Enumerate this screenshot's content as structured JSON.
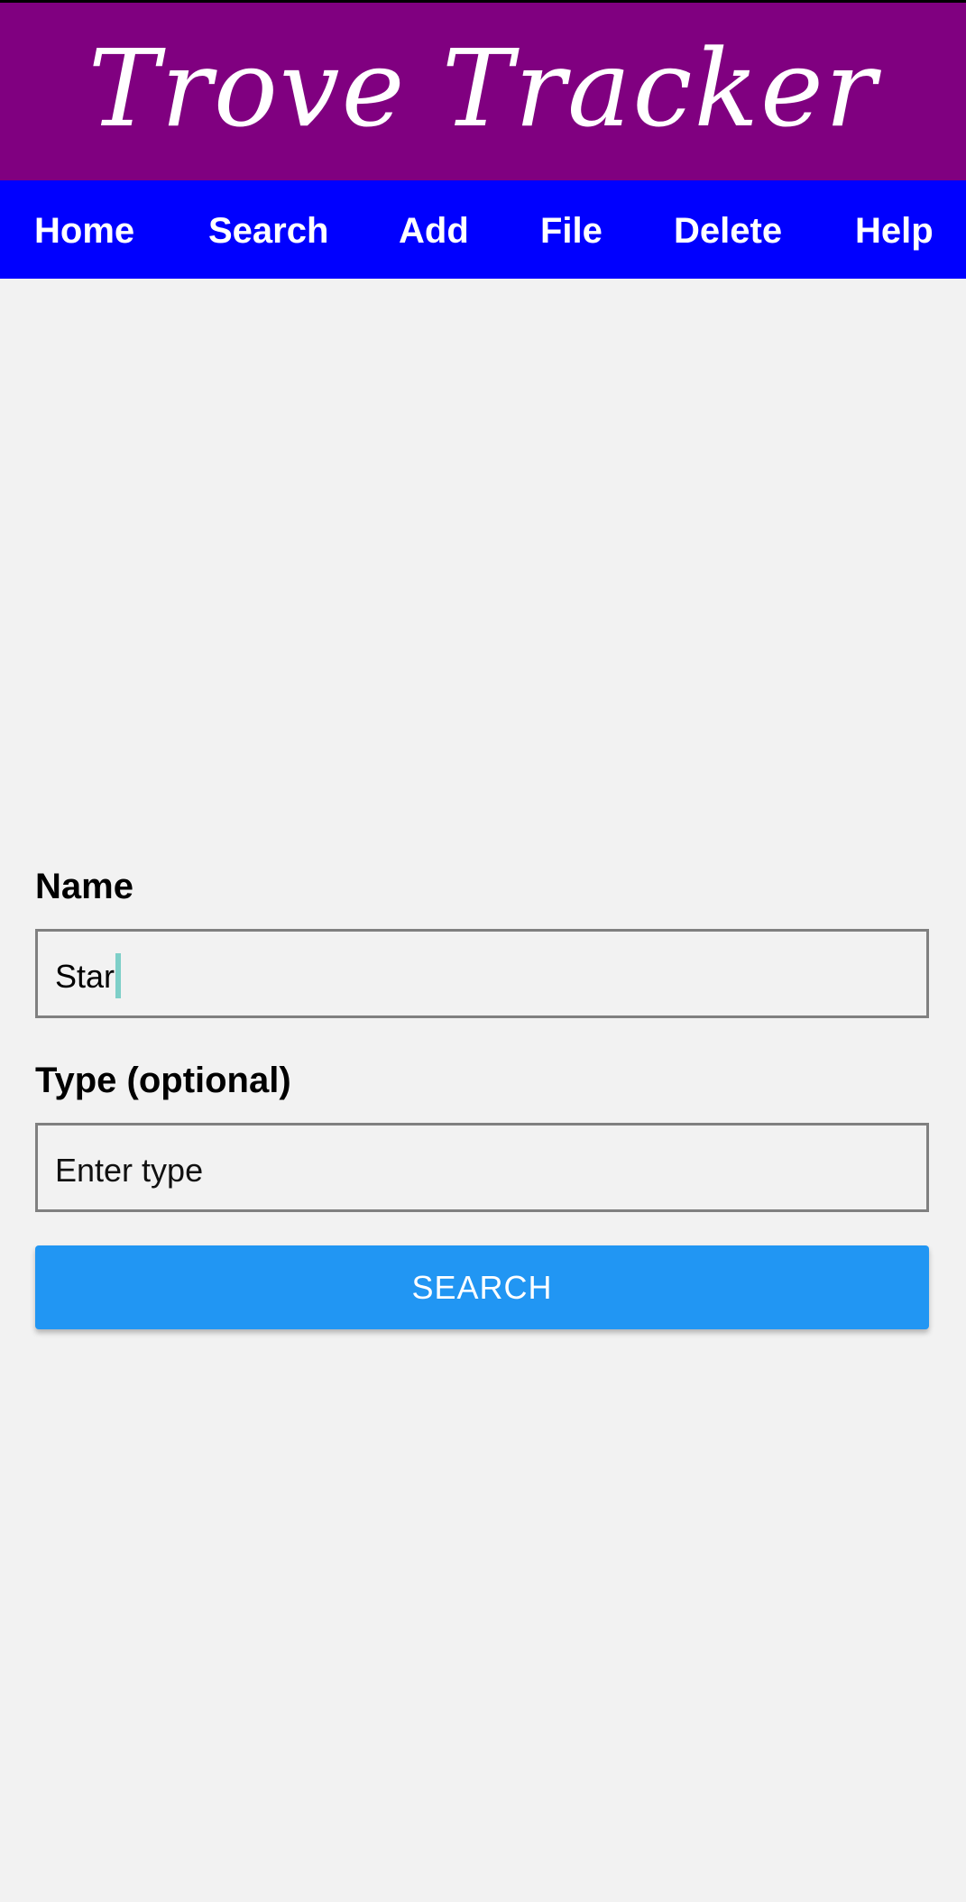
{
  "app": {
    "title": "Trove Tracker"
  },
  "nav": {
    "items": [
      {
        "label": "Home"
      },
      {
        "label": "Search"
      },
      {
        "label": "Add"
      },
      {
        "label": "File"
      },
      {
        "label": "Delete"
      },
      {
        "label": "Help"
      }
    ]
  },
  "form": {
    "name": {
      "label": "Name",
      "value": "Star"
    },
    "type": {
      "label": "Type (optional)",
      "value": "",
      "placeholder": "Enter type"
    },
    "submit_label": "SEARCH"
  },
  "colors": {
    "header_bg": "#800080",
    "nav_bg": "#0000ff",
    "page_bg": "#f2f2f2",
    "button_bg": "#2196f3",
    "caret": "#7ecfc8"
  }
}
